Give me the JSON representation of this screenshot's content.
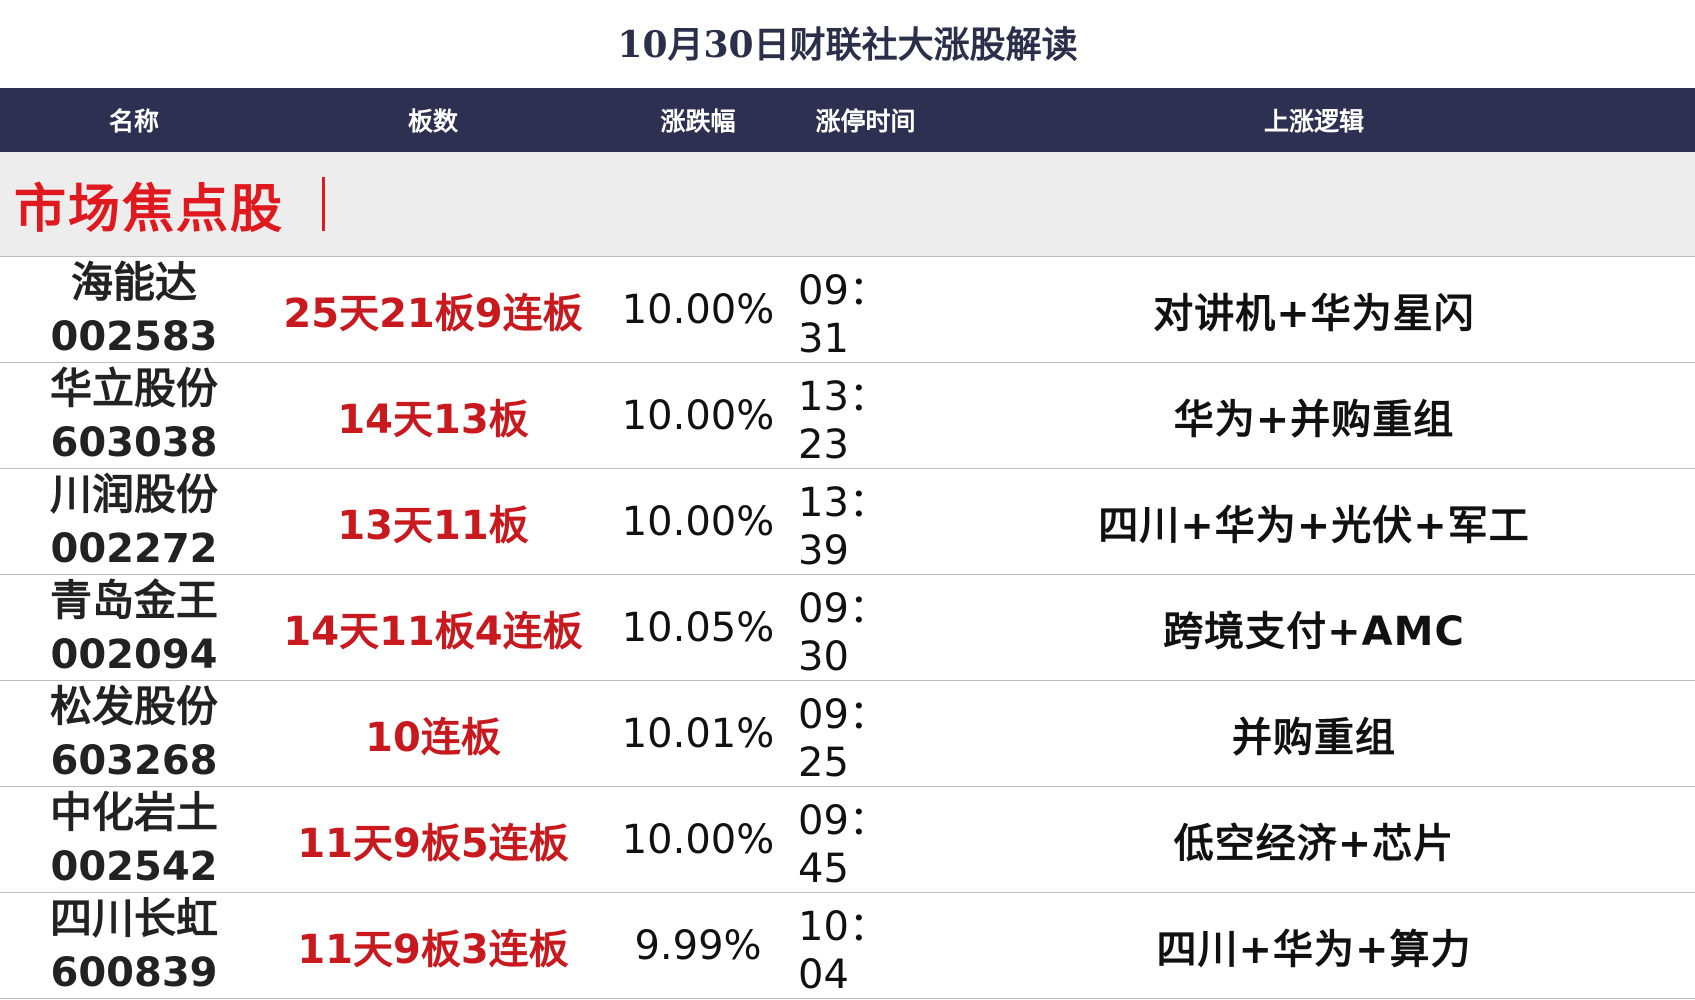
{
  "title": "10月30日财联社大涨股解读",
  "header": {
    "col_name": "名称",
    "col_board": "板数",
    "col_change": "涨跌幅",
    "col_time": "涨停时间",
    "col_logic": "上涨逻辑"
  },
  "section": {
    "title": "市场焦点股"
  },
  "rows": [
    {
      "name": "海能达",
      "code": "002583",
      "board": "25天21板9连板",
      "change": "10.00%",
      "time": "09：31",
      "logic": "对讲机+华为星闪"
    },
    {
      "name": "华立股份",
      "code": "603038",
      "board": "14天13板",
      "change": "10.00%",
      "time": "13：23",
      "logic": "华为+并购重组"
    },
    {
      "name": "川润股份",
      "code": "002272",
      "board": "13天11板",
      "change": "10.00%",
      "time": "13：39",
      "logic": "四川+华为+光伏+军工"
    },
    {
      "name": "青岛金王",
      "code": "002094",
      "board": "14天11板4连板",
      "change": "10.05%",
      "time": "09：30",
      "logic": "跨境支付+AMC"
    },
    {
      "name": "松发股份",
      "code": "603268",
      "board": "10连板",
      "change": "10.01%",
      "time": "09：25",
      "logic": "并购重组"
    },
    {
      "name": "中化岩土",
      "code": "002542",
      "board": "11天9板5连板",
      "change": "10.00%",
      "time": "09：45",
      "logic": "低空经济+芯片"
    },
    {
      "name": "四川长虹",
      "code": "600839",
      "board": "11天9板3连板",
      "change": "9.99%",
      "time": "10：04",
      "logic": "四川+华为+算力"
    }
  ],
  "colors": {
    "header_bg": "#2d3050",
    "section_bg": "#ededed",
    "accent_red": "#e0191f",
    "board_red": "#c8191f"
  }
}
